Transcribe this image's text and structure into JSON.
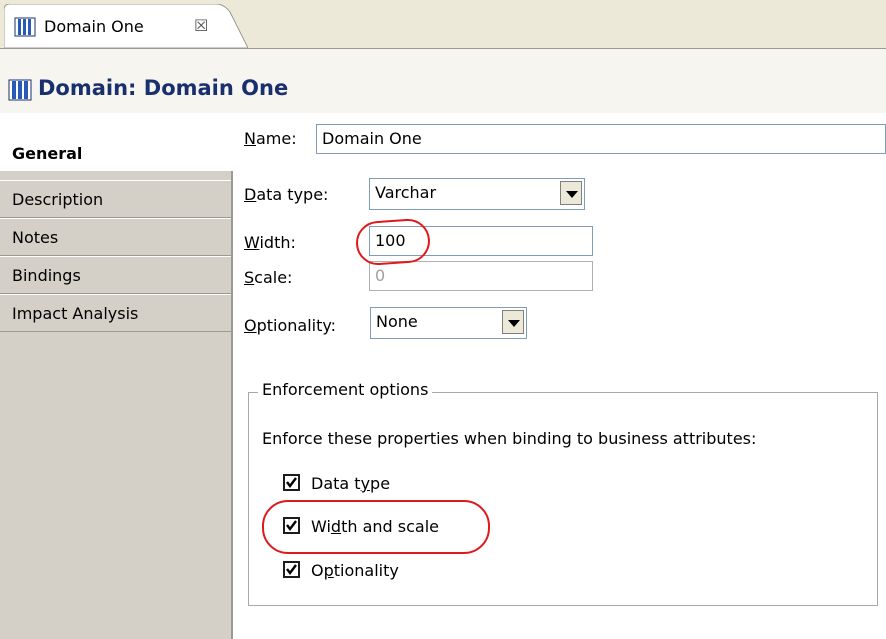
{
  "tab": {
    "label": "Domain One",
    "close": "☒"
  },
  "header": {
    "title": "Domain: Domain One"
  },
  "sidebar": {
    "items": [
      {
        "label": "General",
        "active": true
      },
      {
        "label": "Description"
      },
      {
        "label": "Notes"
      },
      {
        "label": "Bindings"
      },
      {
        "label": "Impact Analysis"
      }
    ]
  },
  "form": {
    "name": {
      "label_mnemonic": "N",
      "label_rest": "ame:",
      "value": "Domain One"
    },
    "data_type": {
      "label_mnemonic": "D",
      "label_rest": "ata type:",
      "value": "Varchar"
    },
    "width": {
      "label_mnemonic": "W",
      "label_rest": "idth:",
      "value": "100"
    },
    "scale": {
      "label_mnemonic": "S",
      "label_rest": "cale:",
      "value": "0"
    },
    "optionality": {
      "label_mnemonic": "O",
      "label_rest": "ptionality:",
      "value": "None"
    }
  },
  "enforcement": {
    "title": "Enforcement options",
    "description": "Enforce these properties when binding to business attributes:",
    "options": [
      {
        "pre": "Data t",
        "mnemonic": "y",
        "post": "pe",
        "checked": true
      },
      {
        "pre": "Wi",
        "mnemonic": "d",
        "post": "th and scale",
        "checked": true
      },
      {
        "pre": "O",
        "mnemonic": "p",
        "post": "tionality",
        "checked": true
      }
    ]
  },
  "colors": {
    "title": "#1a2f6d",
    "highlight": "#e0191b",
    "chrome": "#d4d0c8"
  }
}
